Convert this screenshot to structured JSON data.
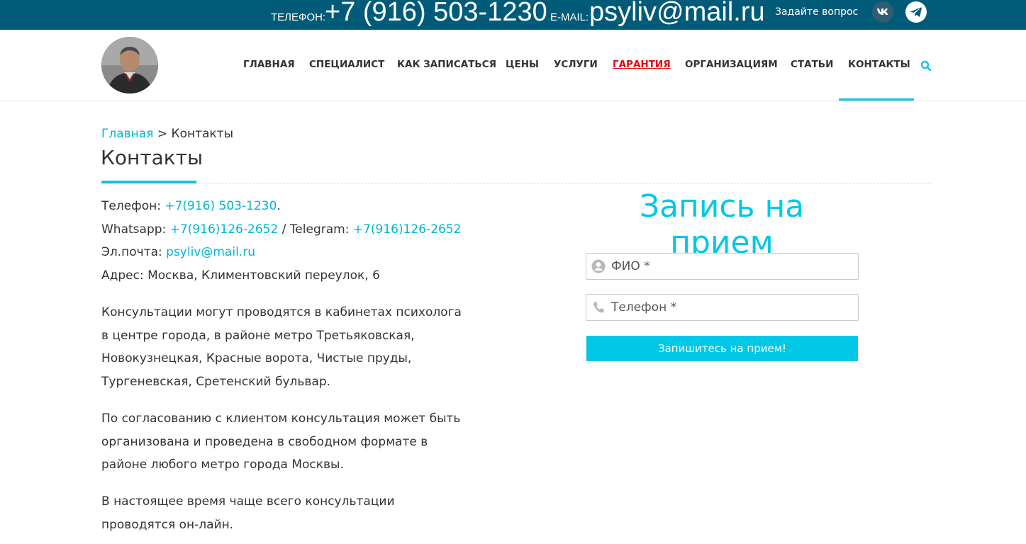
{
  "topbar": {
    "phone_label": "ТЕЛЕФОН:",
    "phone": "+7 (916) 503-1230",
    "email_label": "E-MAIL:",
    "email": "psyliv@mail.ru",
    "ask": "Задайте вопрос",
    "icons": [
      "vk-icon",
      "telegram-icon"
    ]
  },
  "nav": {
    "items": [
      {
        "label": "ГЛАВНАЯ"
      },
      {
        "label": "СПЕЦИАЛИСТ"
      },
      {
        "label": "КАК ЗАПИСАТЬСЯ"
      },
      {
        "label": "ЦЕНЫ"
      },
      {
        "label": "УСЛУГИ"
      },
      {
        "label": "ГАРАНТИЯ"
      },
      {
        "label": "ОРГАНИЗАЦИЯМ"
      },
      {
        "label": "СТАТЬИ"
      },
      {
        "label": "КОНТАКТЫ"
      }
    ],
    "active": "КОНТАКТЫ"
  },
  "breadcrumb": {
    "home": "Главная",
    "separator": " > ",
    "current": "Контакты"
  },
  "page": {
    "title": "Контакты"
  },
  "contacts": {
    "phone_label": "Телефон: ",
    "phone": "+7(916) 503-1230",
    "phone_suffix": ".",
    "whatsapp_label": "Whatsapp: ",
    "whatsapp": "+7(916)126-2652",
    "telegram_label": " / Telegram: ",
    "telegram": "+7(916)126-2652",
    "email_label": "Эл.почта: ",
    "email": "psyliv@mail.ru",
    "address": "Адрес: Москва, Климентовский переулок, 6"
  },
  "paragraphs": [
    "Консультации могут проводятся в кабинетах психолога в центре города, в районе метро Третьяковская, Новокузнецкая, Красные ворота, Чистые пруды, Тургеневская, Сретенский бульвар.",
    "По согласованию с клиентом консультация может быть организована и проведена в свободном формате в районе любого метро города Москвы.",
    "В настоящее время чаще всего консультации проводятся он-лайн."
  ],
  "form": {
    "title": "Запись на прием",
    "name_placeholder": "ФИО *",
    "phone_placeholder": "Телефон *",
    "submit": "Запишитесь на прием!"
  },
  "colors": {
    "topbar": "#005b79",
    "accent": "#00c8e6",
    "link": "#00b4d8",
    "guarantee": "#e30613"
  }
}
